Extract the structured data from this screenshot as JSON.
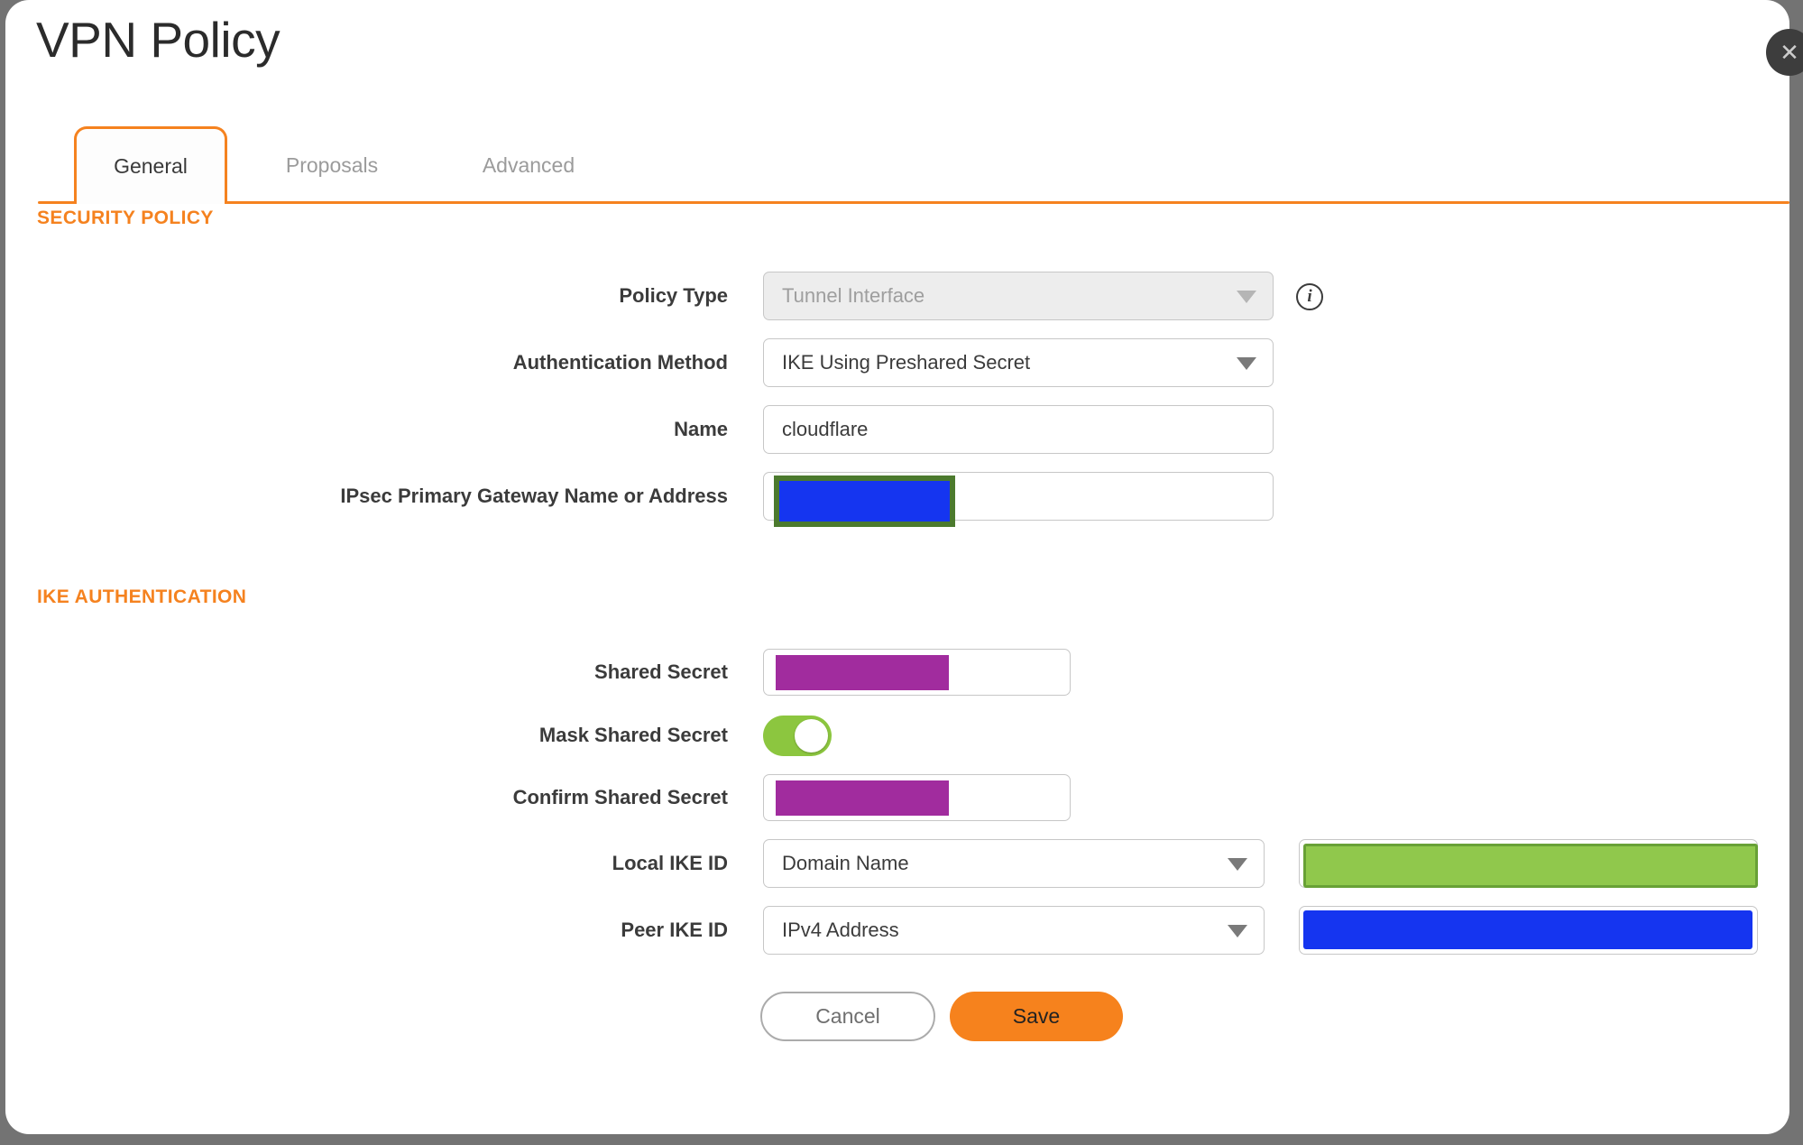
{
  "window": {
    "title": "VPN Policy"
  },
  "icons": {
    "close_glyph": "✕",
    "info_glyph": "i"
  },
  "tabs": [
    {
      "label": "General",
      "active": true
    },
    {
      "label": "Proposals",
      "active": false
    },
    {
      "label": "Advanced",
      "active": false
    }
  ],
  "sections": [
    {
      "heading": "SECURITY POLICY"
    },
    {
      "heading": "IKE AUTHENTICATION"
    }
  ],
  "fields": {
    "policy_type": {
      "label": "Policy Type",
      "value": "Tunnel Interface",
      "disabled": true
    },
    "authentication_method": {
      "label": "Authentication Method",
      "value": "IKE Using Preshared Secret"
    },
    "name": {
      "label": "Name",
      "value": "cloudflare"
    },
    "ipsec_gateway": {
      "label": "IPsec Primary Gateway Name or Address",
      "redacted": true
    },
    "shared_secret": {
      "label": "Shared Secret",
      "redacted": true
    },
    "mask_shared_secret": {
      "label": "Mask Shared Secret",
      "enabled": true
    },
    "confirm_shared_secret": {
      "label": "Confirm Shared Secret",
      "redacted": true
    },
    "local_ike_id": {
      "label": "Local IKE ID",
      "type_value": "Domain Name",
      "redacted": true
    },
    "peer_ike_id": {
      "label": "Peer IKE ID",
      "type_value": "IPv4 Address",
      "redacted": true
    }
  },
  "buttons": {
    "cancel": "Cancel",
    "save": "Save"
  },
  "colors": {
    "accent_orange": "#F5821F",
    "toggle_green": "#8CC63F",
    "redaction_purple": "#A12C9E",
    "redaction_blue": "#1535F0",
    "redaction_green_fill": "#90C84C",
    "redaction_green_border": "#68A136",
    "redaction_olive_border": "#4C7A2E",
    "backdrop_gray": "#737373",
    "close_button_gray": "#3D3D3D"
  }
}
